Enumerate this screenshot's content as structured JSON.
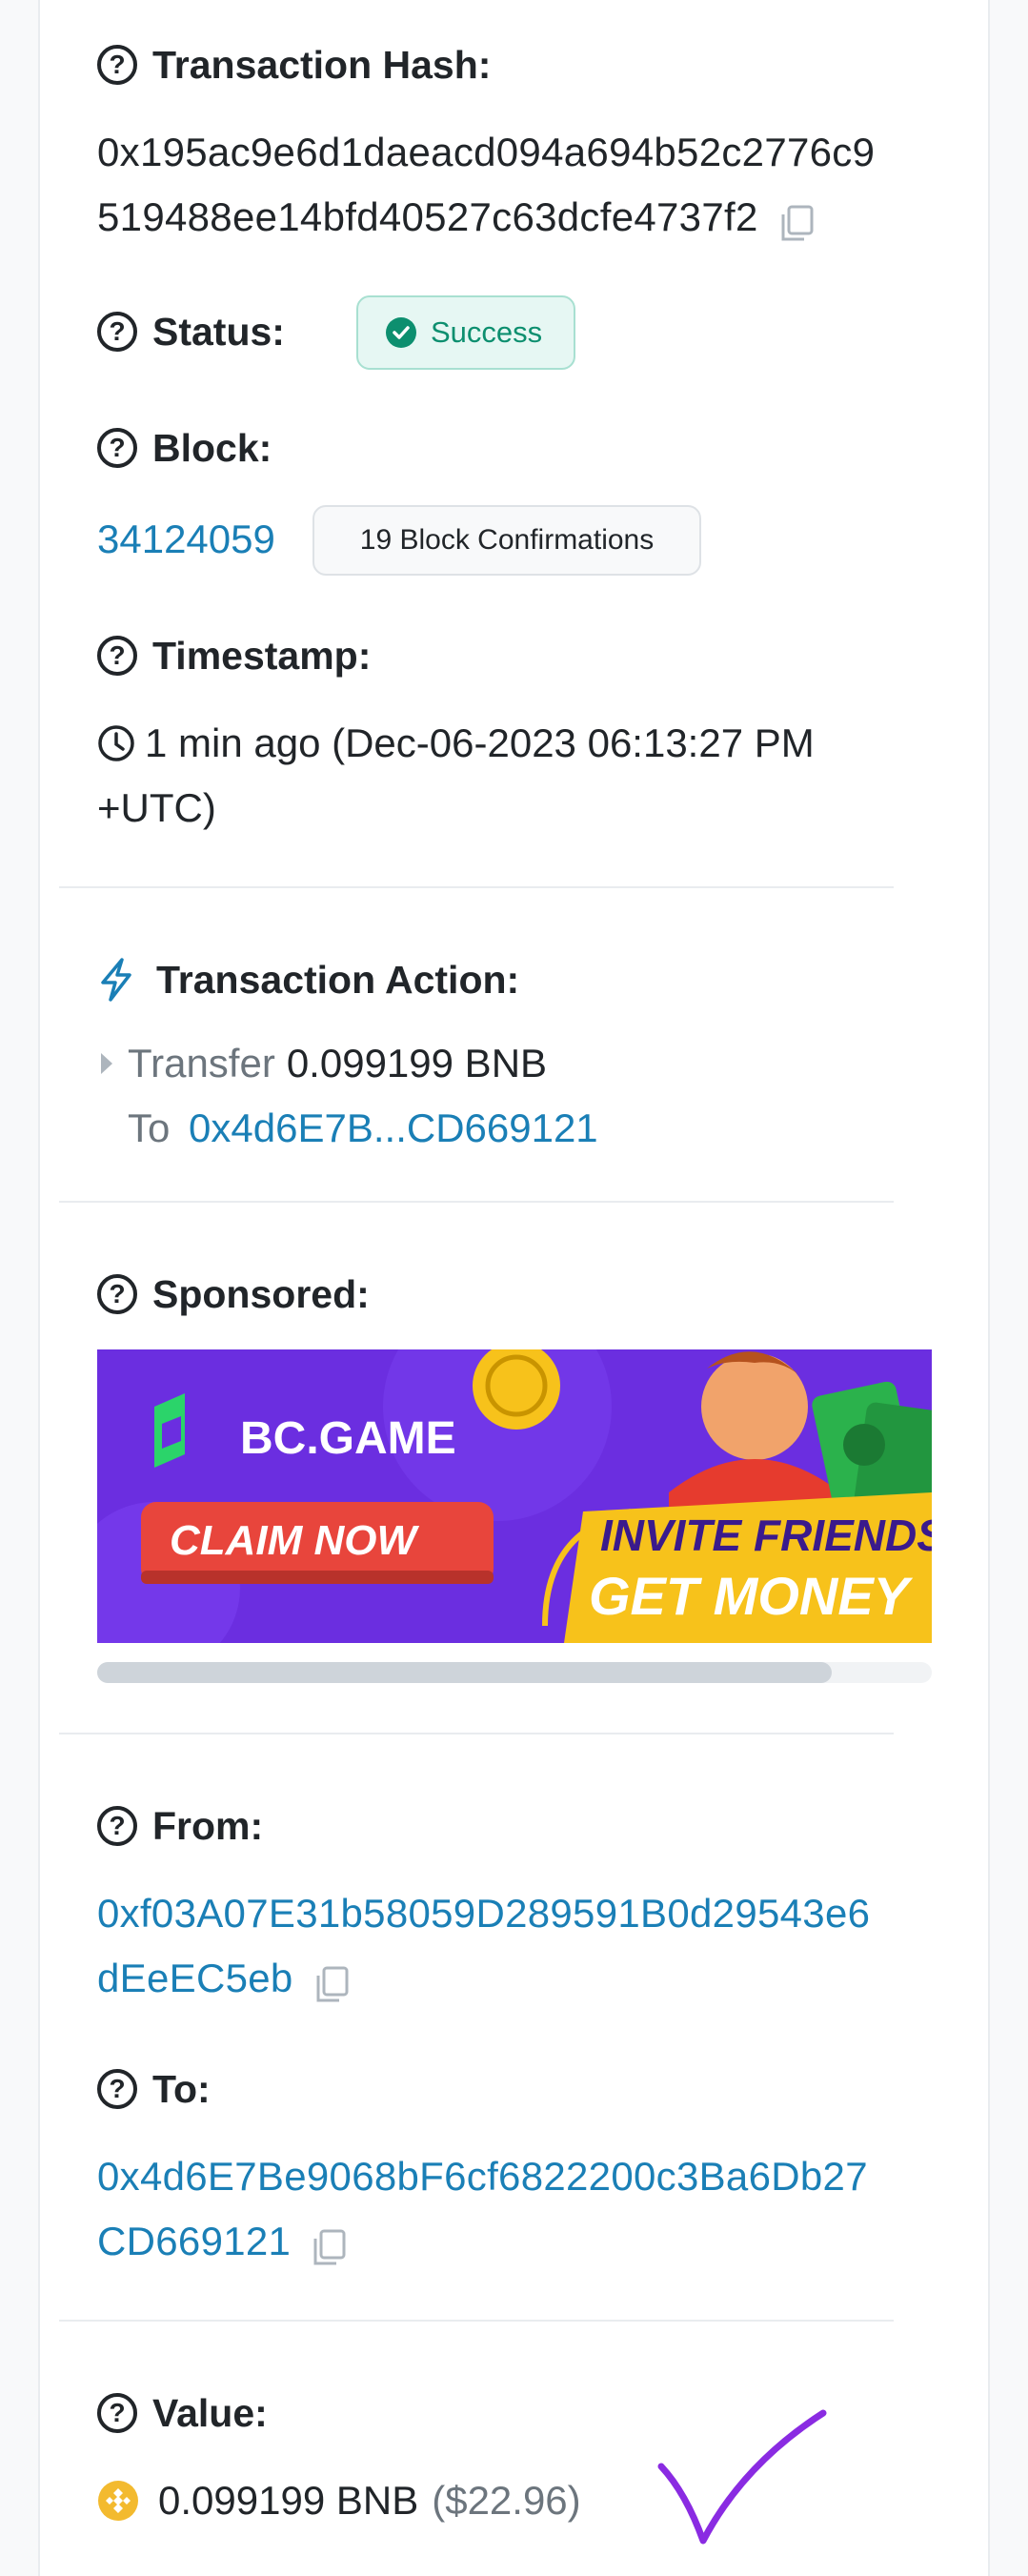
{
  "transaction_hash": {
    "label": "Transaction Hash:",
    "line1": "0x195ac9e6d1daeacd094a694b52c2776c9",
    "line2": "519488ee14bfd40527c63dcfe4737f2"
  },
  "status": {
    "label": "Status:",
    "value": "Success"
  },
  "block": {
    "label": "Block:",
    "number": "34124059",
    "confirmations": "19 Block Confirmations"
  },
  "timestamp": {
    "label": "Timestamp:",
    "line1": "1 min ago (Dec-06-2023 06:13:27 PM",
    "line2": "+UTC)"
  },
  "transaction_action": {
    "label": "Transaction Action:",
    "verb": "Transfer",
    "amount": "0.099199 BNB",
    "to_word": "To",
    "to_address": "0x4d6E7B...CD669121"
  },
  "sponsored": {
    "label": "Sponsored:",
    "brand": "BC.GAME",
    "cta": "CLAIM NOW",
    "headline1": "INVITE FRIENDS",
    "headline2": "GET MONEY",
    "scroll_progress": 0.88
  },
  "from": {
    "label": "From:",
    "line1": "0xf03A07E31b58059D289591B0d29543e6",
    "line2": "dEeEC5eb"
  },
  "to": {
    "label": "To:",
    "line1": "0x4d6E7Be9068bF6cf6822200c3Ba6Db27",
    "line2": "CD669121"
  },
  "value": {
    "label": "Value:",
    "amount": "0.099199 BNB",
    "usd": "($22.96)"
  },
  "colors": {
    "link": "#1a7fb6",
    "success": "#0d8f6f",
    "ad_purple": "#6b2ee0",
    "ad_yellow": "#f7c21b",
    "annotation": "#8a2be2"
  },
  "icons": [
    "question-icon",
    "copy-icon",
    "check-circle-icon",
    "clock-icon",
    "lightning-icon",
    "caret-right-icon",
    "bnb-icon",
    "checkmark-annotation-icon"
  ]
}
